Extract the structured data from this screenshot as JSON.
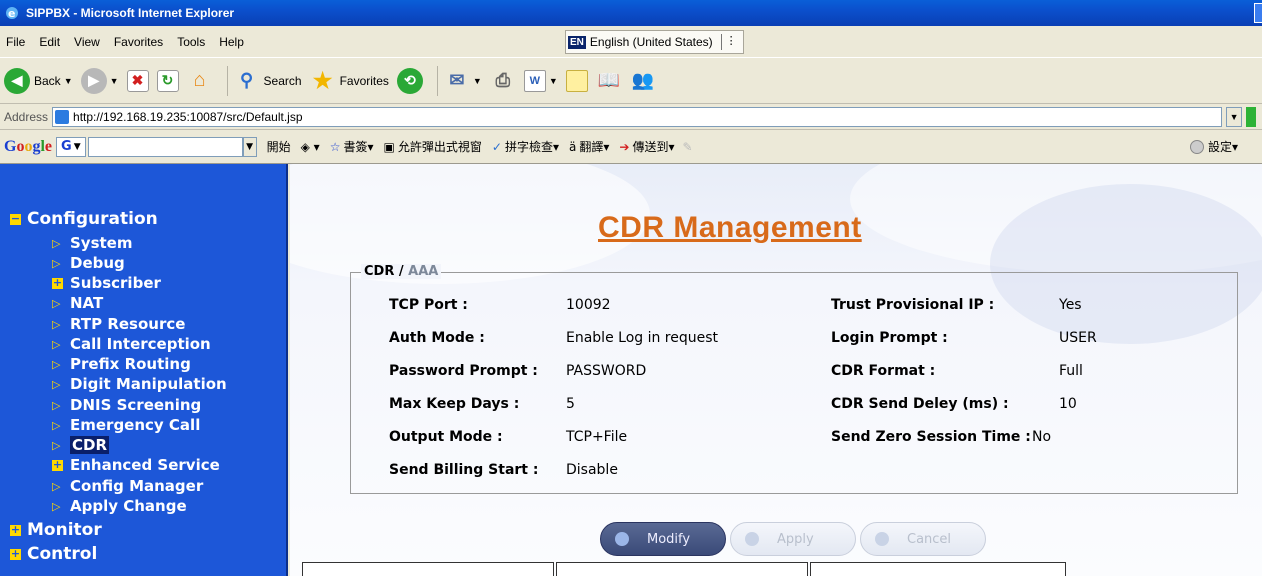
{
  "window": {
    "title": "SIPPBX - Microsoft Internet Explorer"
  },
  "menu": {
    "items": [
      "File",
      "Edit",
      "View",
      "Favorites",
      "Tools",
      "Help"
    ],
    "language": {
      "code": "EN",
      "label": "English (United States)"
    }
  },
  "toolbar": {
    "back_label": "Back",
    "search_label": "Search",
    "favorites_label": "Favorites"
  },
  "address": {
    "label": "Address",
    "url": "http://192.168.19.235:10087/src/Default.jsp"
  },
  "googlebar": {
    "logo": "Google",
    "g_button": "G",
    "start": "開始",
    "bookmarks": "書簽",
    "popups": "允許彈出式視窗",
    "spellcheck": "拼字檢查",
    "translate": "翻譯",
    "sendto": "傳送到",
    "settings": "設定"
  },
  "sidebar": {
    "configuration": "Configuration",
    "items": [
      {
        "label": "System",
        "type": "arrow"
      },
      {
        "label": "Debug",
        "type": "arrow"
      },
      {
        "label": "Subscriber",
        "type": "plus"
      },
      {
        "label": "NAT",
        "type": "arrow"
      },
      {
        "label": "RTP Resource",
        "type": "arrow"
      },
      {
        "label": "Call Interception",
        "type": "arrow"
      },
      {
        "label": "Prefix Routing",
        "type": "arrow"
      },
      {
        "label": "Digit Manipulation",
        "type": "arrow"
      },
      {
        "label": "DNIS Screening",
        "type": "arrow"
      },
      {
        "label": "Emergency Call",
        "type": "arrow"
      },
      {
        "label": "CDR",
        "type": "arrow"
      },
      {
        "label": "Enhanced Service",
        "type": "plus"
      },
      {
        "label": "Config Manager",
        "type": "arrow"
      },
      {
        "label": "Apply Change",
        "type": "arrow"
      }
    ],
    "monitor": "Monitor",
    "control": "Control"
  },
  "main": {
    "title": "CDR Management",
    "legend_cdr": "CDR / ",
    "legend_aaa": "AAA",
    "left_fields": [
      {
        "label": "TCP Port :",
        "value": "10092"
      },
      {
        "label": "Auth Mode :",
        "value": "Enable Log in request"
      },
      {
        "label": "Password Prompt :",
        "value": "PASSWORD"
      },
      {
        "label": "Max Keep Days :",
        "value": "5"
      },
      {
        "label": "Output Mode :",
        "value": "TCP+File"
      },
      {
        "label": "Send Billing Start :",
        "value": "Disable"
      }
    ],
    "right_fields": [
      {
        "label": "Trust Provisional IP :",
        "value": "Yes"
      },
      {
        "label": "Login Prompt :",
        "value": "USER"
      },
      {
        "label": "CDR Format :",
        "value": "Full"
      },
      {
        "label": "CDR Send Deley (ms) :",
        "value": "10"
      },
      {
        "label": "Send Zero Session Time :",
        "value": "No"
      }
    ],
    "buttons": {
      "modify": "Modify",
      "apply": "Apply",
      "cancel": "Cancel"
    }
  }
}
